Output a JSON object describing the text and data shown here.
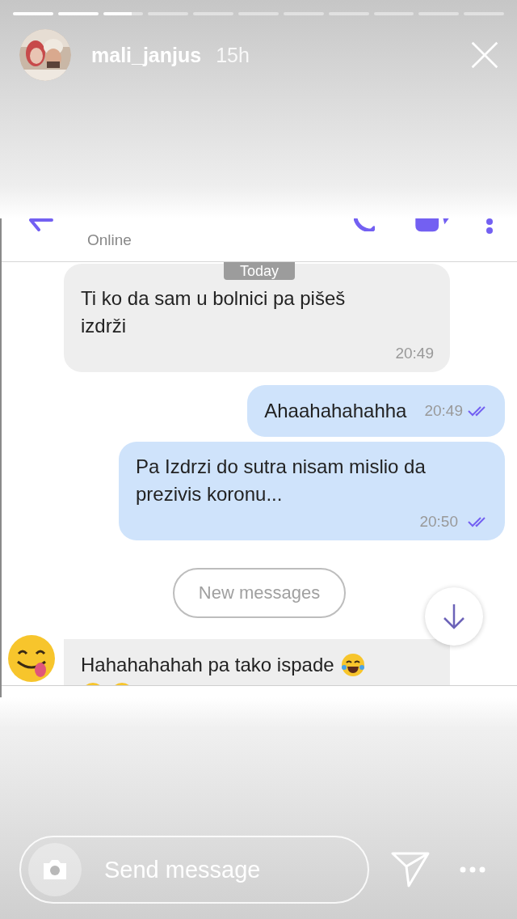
{
  "story_progress": [
    {
      "seen": true,
      "current": false
    },
    {
      "seen": true,
      "current": false
    },
    {
      "seen": false,
      "current": true
    },
    {
      "seen": false,
      "current": false
    },
    {
      "seen": false,
      "current": false
    },
    {
      "seen": false,
      "current": false
    },
    {
      "seen": false,
      "current": false
    },
    {
      "seen": false,
      "current": false
    },
    {
      "seen": false,
      "current": false
    },
    {
      "seen": false,
      "current": false
    },
    {
      "seen": false,
      "current": false
    }
  ],
  "story_header": {
    "username": "mali_janjus",
    "time": "15h"
  },
  "chat": {
    "status": "Online",
    "date_label": "Today",
    "messages": [
      {
        "kind": "incoming",
        "lines": [
          "Ti ko da sam u bolnici pa pišeš",
          "izdrži"
        ],
        "time": "20:49"
      },
      {
        "kind": "outgoing_inline",
        "lines": [
          "Ahaahahahahha"
        ],
        "time": "20:49"
      },
      {
        "kind": "outgoing",
        "lines": [
          "Pa Izdrzi do sutra nisam mislio da",
          "prezivis koronu..."
        ],
        "time": "20:50"
      }
    ],
    "new_messages_label": "New messages",
    "last_message": {
      "text": "Hahahahahah pa tako ispade"
    }
  },
  "reply_bar": {
    "placeholder": "Send message"
  }
}
